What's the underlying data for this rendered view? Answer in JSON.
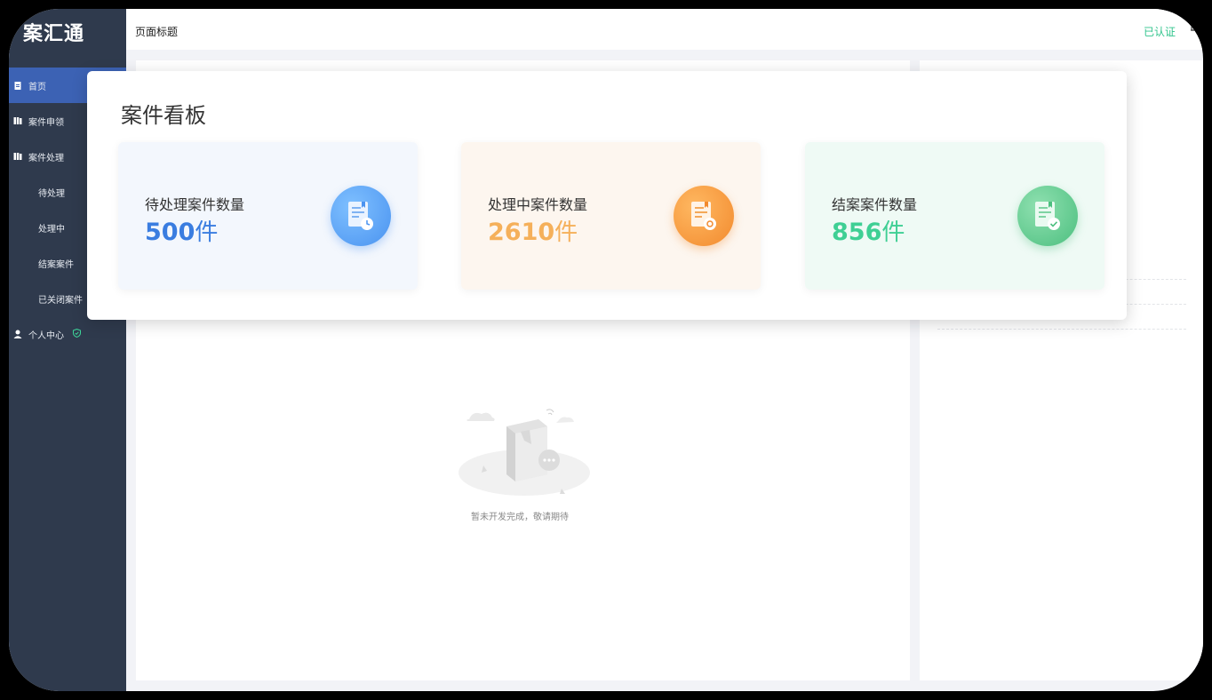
{
  "app": {
    "logo": "案汇通"
  },
  "header": {
    "page_title": "页面标题",
    "certified": "已认证"
  },
  "sidebar": {
    "items": [
      {
        "label": "首页",
        "icon": "clipboard-icon",
        "active": true
      },
      {
        "label": "案件申领",
        "icon": "books-icon"
      },
      {
        "label": "案件处理",
        "icon": "books-icon"
      },
      {
        "label": "待处理"
      },
      {
        "label": "处理中"
      },
      {
        "label": "结案案件"
      },
      {
        "label": "已关闭案件"
      },
      {
        "label": "个人中心",
        "icon": "user-icon",
        "badge_icon": "shield-check-icon"
      }
    ]
  },
  "board": {
    "title": "案件看板",
    "cards": [
      {
        "label": "待处理案件数量",
        "value": "500",
        "unit": "件",
        "color": "#3a7de0",
        "icon": "document-clock-icon"
      },
      {
        "label": "处理中案件数量",
        "value": "2610",
        "unit": "件",
        "color": "#f5b05a",
        "icon": "document-gear-icon"
      },
      {
        "label": "结案案件数量",
        "value": "856",
        "unit": "件",
        "color": "#3fcf94",
        "icon": "document-check-icon"
      }
    ]
  },
  "empty_state": {
    "text": "暂未开发完成，敬请期待",
    "icon": "empty-box-illustration"
  },
  "colors": {
    "sidebar": "#2f3a4d",
    "active": "#3c62b4",
    "accent_green": "#31c48d"
  }
}
